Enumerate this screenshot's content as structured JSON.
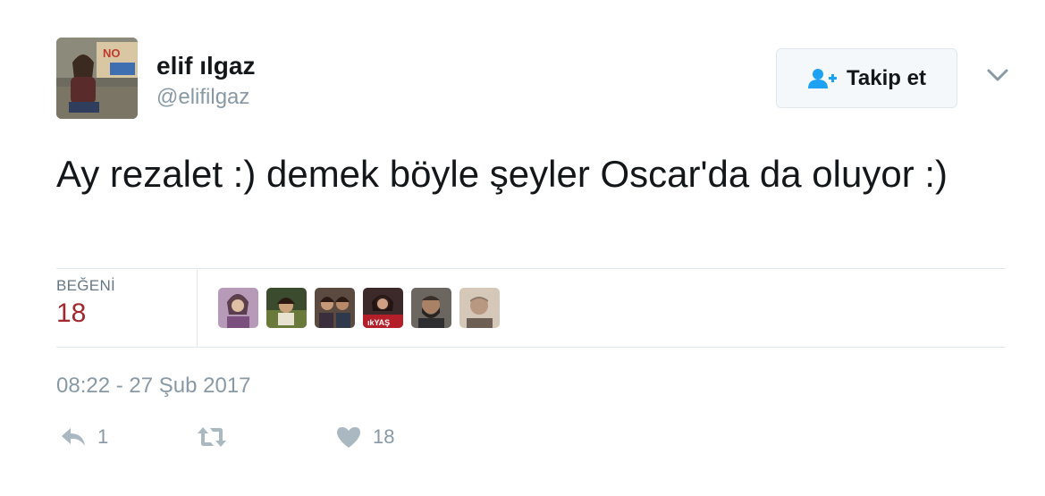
{
  "user": {
    "name": "elif ılgaz",
    "handle": "@elifilgaz",
    "avatar_icon": "profile-photo"
  },
  "follow_button": {
    "label": "Takip et",
    "icon": "add-user-icon",
    "accent": "#1da1f2"
  },
  "tweet": {
    "text": "Ay rezalet :) demek böyle şeyler Oscar'da da oluyor :)",
    "timestamp": "08:22 - 27 Şub 2017"
  },
  "likes": {
    "label": "BEĞENİ",
    "count": "18",
    "count_color": "#a1282f",
    "liker_avatars": [
      "liker-avatar-1",
      "liker-avatar-2",
      "liker-avatar-3",
      "liker-avatar-4",
      "liker-avatar-5",
      "liker-avatar-6"
    ]
  },
  "actions": {
    "reply_count": "1",
    "retweet_count": "",
    "like_count": "18"
  }
}
